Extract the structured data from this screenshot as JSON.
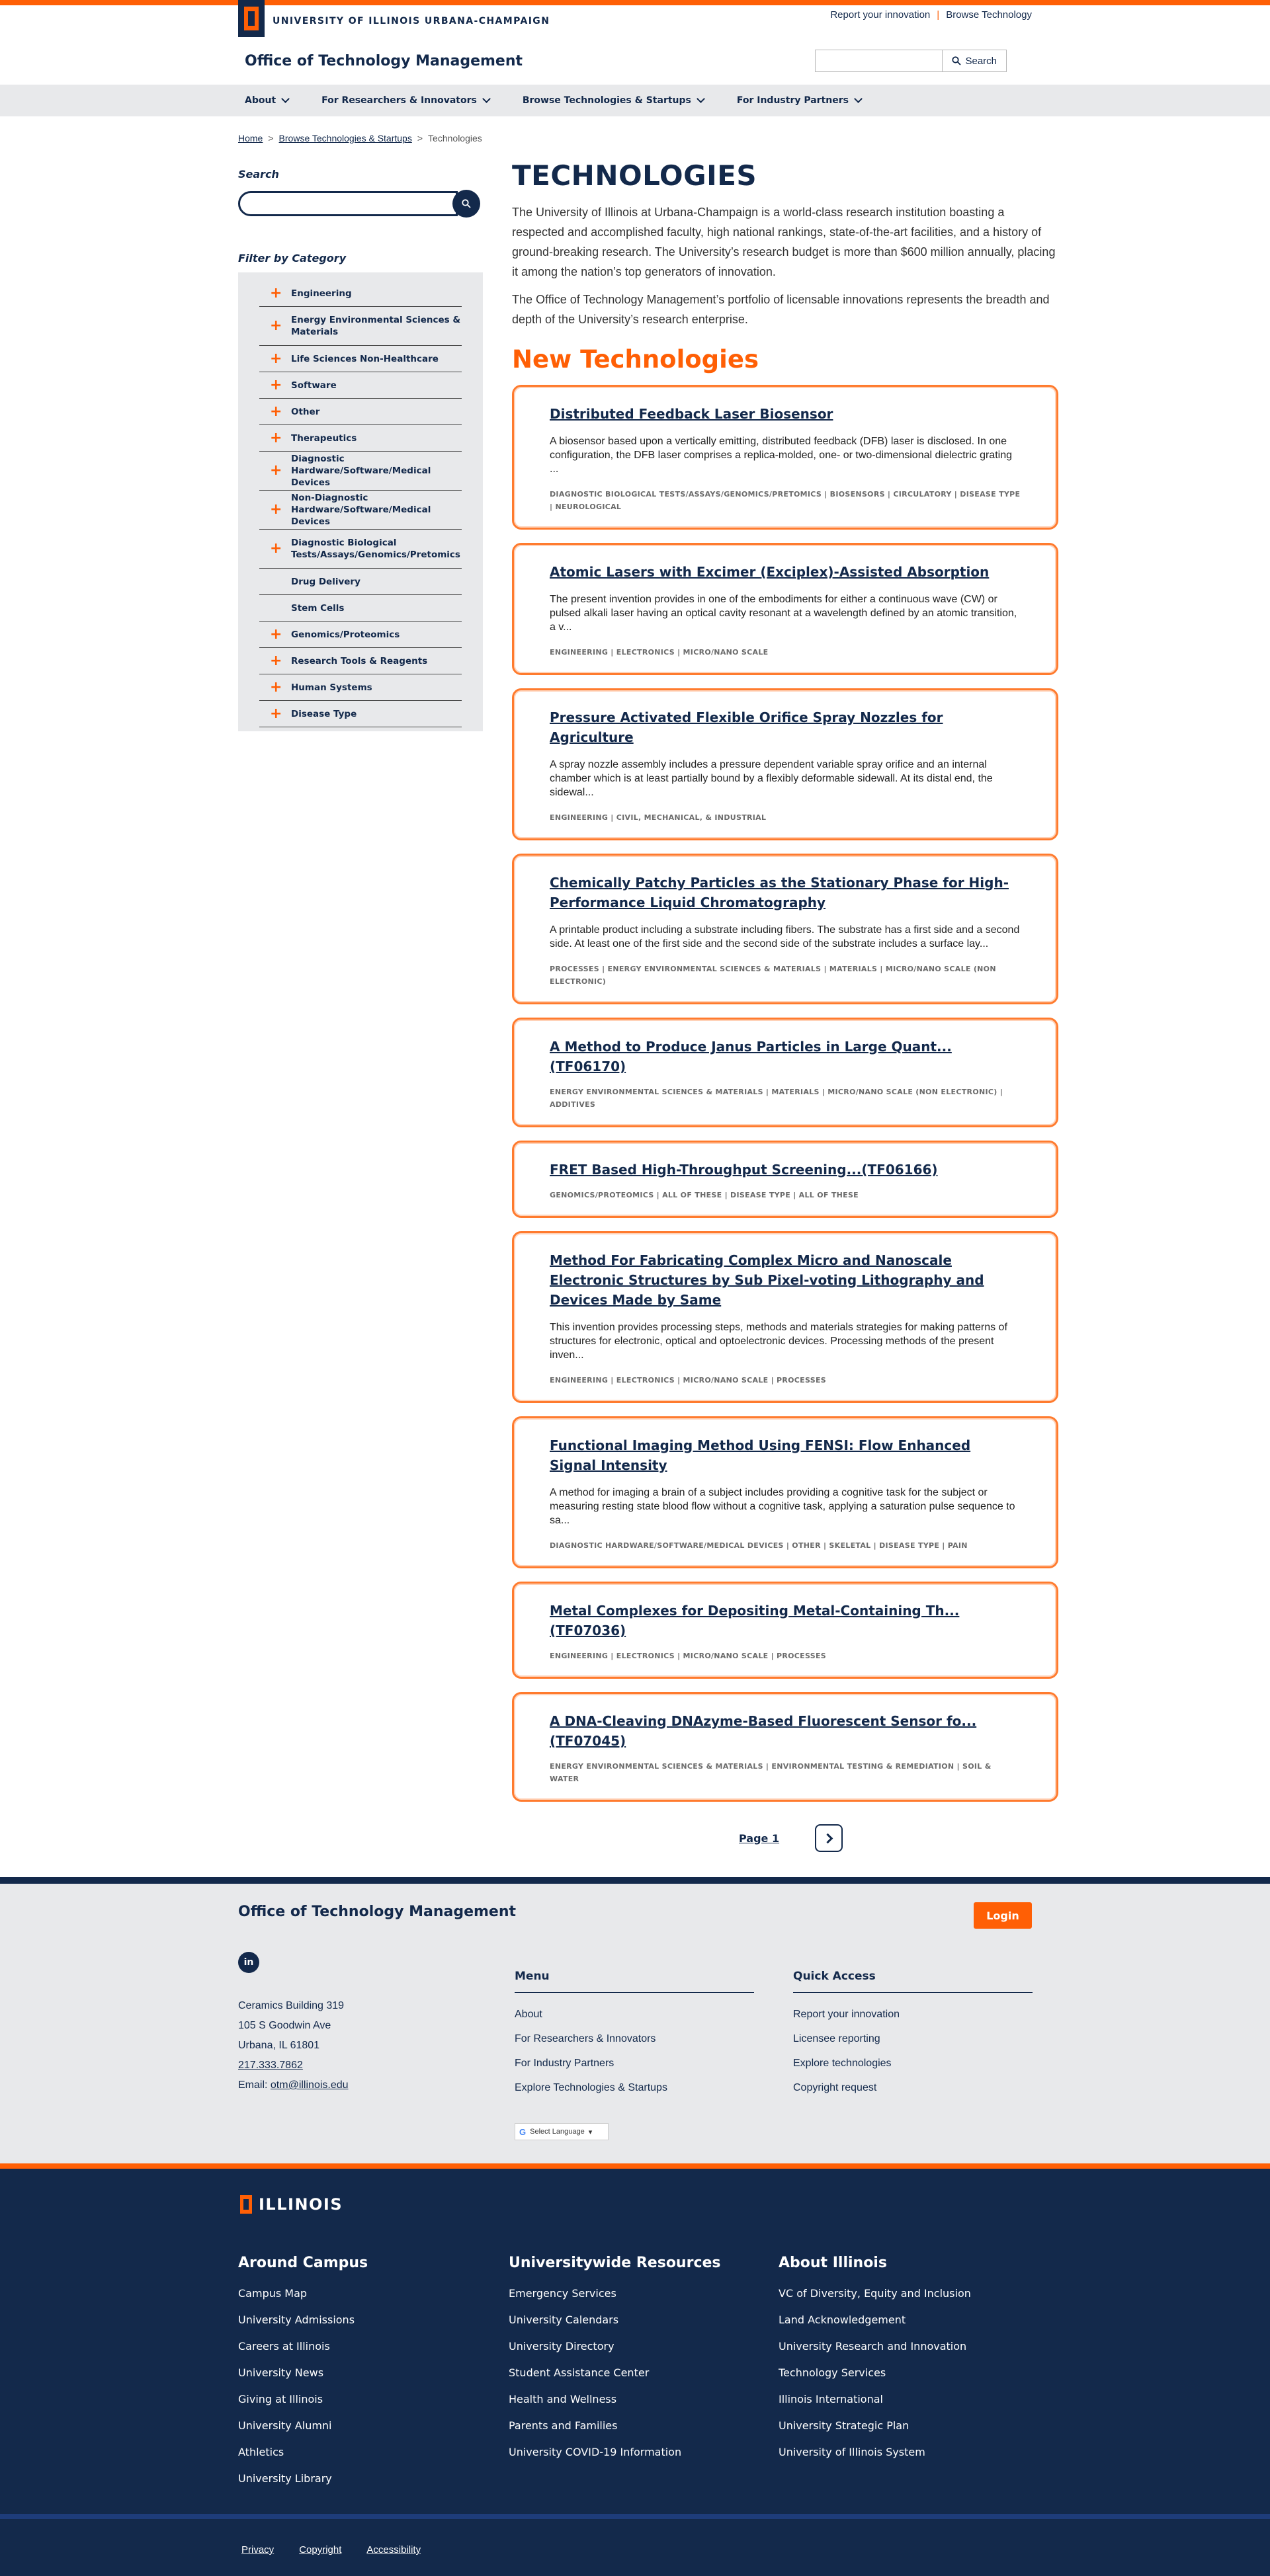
{
  "brand": {
    "university": "UNIVERSITY OF ILLINOIS URBANA-CHAMPAIGN",
    "site_title": "Office of Technology Management"
  },
  "utility_links": [
    "Report your innovation",
    "Browse Technology"
  ],
  "header_search": {
    "placeholder": "",
    "button": "Search"
  },
  "nav": [
    {
      "label": "About"
    },
    {
      "label": "For Researchers & Innovators"
    },
    {
      "label": "Browse Technologies & Startups"
    },
    {
      "label": "For Industry Partners"
    }
  ],
  "breadcrumb": {
    "home": "Home",
    "section": "Browse Technologies & Startups",
    "current": "Technologies",
    "sep": ">"
  },
  "sidebar": {
    "search_label": "Search",
    "filter_label": "Filter by Category",
    "categories": [
      {
        "label": "Engineering",
        "expandable": true
      },
      {
        "label": "Energy Environmental Sciences & Materials",
        "expandable": true
      },
      {
        "label": "Life Sciences Non-Healthcare",
        "expandable": true
      },
      {
        "label": "Software",
        "expandable": true
      },
      {
        "label": "Other",
        "expandable": true
      },
      {
        "label": "Therapeutics",
        "expandable": true
      },
      {
        "label": "Diagnostic Hardware/Software/Medical Devices",
        "expandable": true
      },
      {
        "label": "Non-Diagnostic Hardware/Software/Medical Devices",
        "expandable": true
      },
      {
        "label": "Diagnostic Biological Tests/Assays/Genomics/Pretomics",
        "expandable": true
      },
      {
        "label": "Drug Delivery",
        "expandable": false
      },
      {
        "label": "Stem Cells",
        "expandable": false
      },
      {
        "label": "Genomics/Proteomics",
        "expandable": true
      },
      {
        "label": "Research Tools & Reagents",
        "expandable": true
      },
      {
        "label": "Human Systems",
        "expandable": true
      },
      {
        "label": "Disease Type",
        "expandable": true
      }
    ]
  },
  "main": {
    "title": "TECHNOLOGIES",
    "intro1": "The University of Illinois at Urbana-Champaign is a world-class research institution boasting a respected and accomplished faculty, high national rankings, state-of-the-art facilities, and a history of ground-breaking research. The University’s research budget is more than $600 million annually, placing it among the nation’s top generators of innovation.",
    "intro2": "The Office of Technology Management’s portfolio of licensable innovations represents the breadth and depth of the University’s research enterprise.",
    "new_heading": "New Technologies",
    "technologies": [
      {
        "title": "Distributed Feedback Laser Biosensor",
        "description": "A biosensor based upon a vertically emitting, distributed feedback (DFB) laser is disclosed. In one configuration, the DFB laser comprises a replica-molded, one- or two-dimensional dielectric grating ...",
        "tags": "Diagnostic Biological Tests/Assays/Genomics/Pretomics | Biosensors | Circulatory | Disease Type | Neurological"
      },
      {
        "title": "Atomic Lasers with Excimer (Exciplex)-Assisted Absorption",
        "description": "The present invention provides in one of the embodiments for either a continuous wave (CW) or pulsed alkali laser having an optical cavity resonant at a wavelength defined by an atomic transition, a v...",
        "tags": "Engineering | Electronics | Micro/Nano Scale"
      },
      {
        "title": "Pressure Activated Flexible Orifice Spray Nozzles for Agriculture",
        "description": "A spray nozzle assembly includes a pressure dependent variable spray orifice and an internal chamber which is at least partially bound by a flexibly deformable sidewall. At its distal end, the sidewal...",
        "tags": "Engineering | Civil, Mechanical, & Industrial"
      },
      {
        "title": "Chemically Patchy Particles as the Stationary Phase for High-Performance Liquid Chromatography",
        "description": "A printable product including a substrate including fibers. The substrate has a first side and a second side. At least one of the first side and the second side of the substrate includes a surface lay...",
        "tags": "Processes | Energy Environmental Sciences & Materials | Materials | Micro/Nano Scale (Non Electronic)"
      },
      {
        "title": "A Method to Produce Janus Particles in Large Quant...(TF06170)",
        "description": "",
        "tags": "Energy Environmental Sciences & Materials | Materials | Micro/Nano Scale (Non Electronic) | Additives"
      },
      {
        "title": "FRET Based High-Throughput Screening...(TF06166)",
        "description": "",
        "tags": "Genomics/Proteomics | All of These | Disease Type | All of These"
      },
      {
        "title": "Method For Fabricating Complex Micro and Nanoscale Electronic Structures by Sub Pixel-voting Lithography and Devices Made by Same",
        "description": "This invention provides processing steps, methods and materials strategies for making patterns of structures for electronic, optical and optoelectronic devices. Processing methods of the present inven...",
        "tags": "Engineering | Electronics | Micro/Nano Scale | Processes"
      },
      {
        "title": "Functional Imaging Method Using FENSI: Flow Enhanced Signal Intensity",
        "description": "A method for imaging a brain of a subject includes providing a cognitive task for the subject or measuring resting state blood flow without a cognitive task, applying a saturation pulse sequence to sa...",
        "tags": "Diagnostic Hardware/Software/Medical Devices | Other | Skeletal | Disease Type | Pain"
      },
      {
        "title": "Metal Complexes for Depositing Metal-Containing Th...(TF07036)",
        "description": "",
        "tags": "Engineering | Electronics | Micro/Nano Scale | Processes"
      },
      {
        "title": "A DNA-Cleaving DNAzyme-Based Fluorescent Sensor fo...(TF07045)",
        "description": "",
        "tags": "Energy Environmental Sciences & Materials | Environmental Testing & Remediation | Soil & Water"
      }
    ],
    "pager": {
      "label": "Page 1"
    }
  },
  "footer": {
    "title": "Office of Technology Management",
    "login": "Login",
    "linkedin": "in",
    "address": [
      "Ceramics Building 319",
      "105 S Goodwin Ave",
      "Urbana, IL 61801"
    ],
    "phone": "217.333.7862",
    "email_prefix": "Email: ",
    "email": "otm@illinois.edu",
    "menu": {
      "title": "Menu",
      "items": [
        "About",
        "For Researchers & Innovators",
        "For Industry Partners",
        "Explore Technologies & Startups"
      ]
    },
    "quick": {
      "title": "Quick Access",
      "items": [
        "Report your innovation",
        "Licensee reporting",
        "Explore technologies",
        "Copyright request"
      ]
    },
    "language": "Select Language"
  },
  "campus_footer": {
    "wordmark": "ILLINOIS",
    "columns": [
      {
        "title": "Around Campus",
        "items": [
          "Campus Map",
          "University Admissions",
          "Careers at Illinois",
          "University News",
          "Giving at Illinois",
          "University Alumni",
          "Athletics",
          "University Library"
        ]
      },
      {
        "title": "Universitywide Resources",
        "items": [
          "Emergency Services",
          "University Calendars",
          "University Directory",
          "Student Assistance Center",
          "Health and Wellness",
          "Parents and Families",
          "University COVID-19 Information"
        ]
      },
      {
        "title": "About Illinois",
        "items": [
          "VC of Diversity, Equity and Inclusion",
          "Land Acknowledgement",
          "University Research and Innovation",
          "Technology Services",
          "Illinois International",
          "University Strategic Plan",
          "University of Illinois System"
        ]
      }
    ],
    "legal": [
      "Privacy",
      "Copyright",
      "Accessibility"
    ]
  },
  "colors": {
    "navy": "#13294b",
    "orange": "#ff5f05",
    "light_gray": "#e8e9eb"
  }
}
